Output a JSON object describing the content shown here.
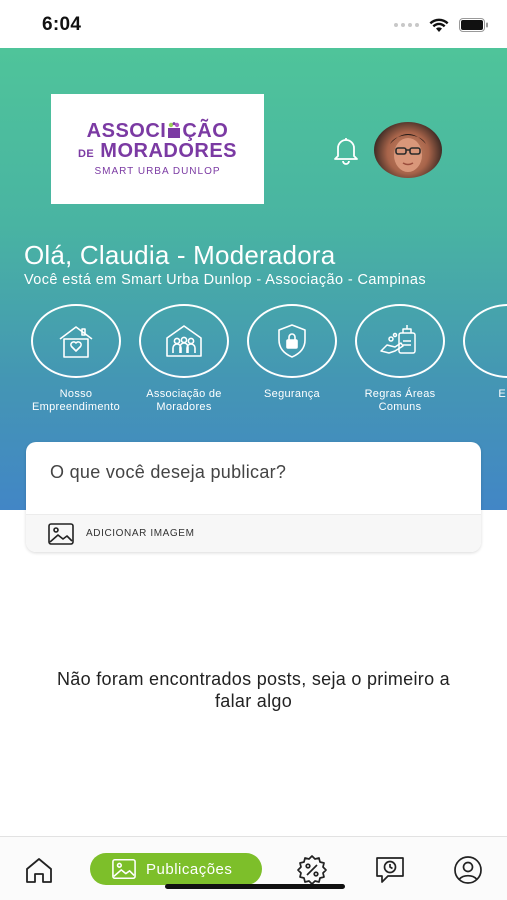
{
  "status_bar": {
    "time": "6:04"
  },
  "logo": {
    "line1_a": "ASSOCI",
    "line1_b": "ÇÃO",
    "line2_prefix": "DE",
    "line2": "MORADORES",
    "subtitle": "SMART URBA DUNLOP"
  },
  "header": {
    "greeting": "Olá, Claudia - Moderadora",
    "location": "Você está em Smart Urba Dunlop - Associação - Campinas"
  },
  "categories": [
    {
      "label": "Nosso Empreendimento",
      "icon": "house-icon"
    },
    {
      "label": "Associação de Moradores",
      "icon": "people-icon"
    },
    {
      "label": "Segurança",
      "icon": "shield-lock-icon"
    },
    {
      "label": "Regras Áreas Comuns",
      "icon": "rules-icon"
    },
    {
      "label": "E D",
      "icon": "partial-icon"
    }
  ],
  "publish": {
    "prompt": "O que você deseja publicar?",
    "add_image": "ADICIONAR IMAGEM"
  },
  "empty_state": {
    "message": "Não foram encontrados posts, seja o primeiro a falar algo"
  },
  "bottom_nav": {
    "active_label": "Publicações",
    "items": [
      "home-icon",
      "publications-icon",
      "discount-icon",
      "chat-clock-icon",
      "profile-icon"
    ]
  },
  "colors": {
    "accent": "#7dbf2a",
    "logo_purple": "#7b3aa3",
    "gradient_top": "#4fc49a",
    "gradient_bottom": "#4286c6"
  }
}
